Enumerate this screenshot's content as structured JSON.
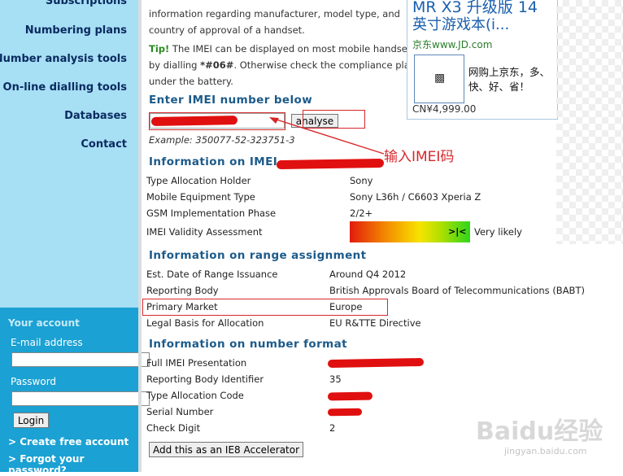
{
  "nav": {
    "items": [
      "Subscriptions",
      "Numbering plans",
      "Number analysis tools",
      "On-line dialling tools",
      "Databases",
      "Contact"
    ]
  },
  "account": {
    "heading": "Your account",
    "email_label": "E-mail address",
    "password_label": "Password",
    "login_label": "Login",
    "create_link": "> Create free account",
    "forgot_link": "> Forgot your password?"
  },
  "intro": {
    "line1": "information regarding manufacturer, model type, and",
    "line2": "country of approval of a handset.",
    "tip_label": "Tip!",
    "tip_line1": " The IMEI can be displayed on most mobile handsets",
    "tip_line2_a": "by dialling ",
    "tip_code": "*#06#",
    "tip_line2_b": ". Otherwise check the compliance plate",
    "tip_line3": "under the battery."
  },
  "enter": {
    "heading": "Enter IMEI number below",
    "analyse_label": "analyse",
    "example": "Example: 350077-52-323751-3",
    "annotation": "输入IMEI码"
  },
  "info_imei": {
    "heading": "Information on IMEI",
    "rows": [
      {
        "label": "Type Allocation Holder",
        "value": "Sony"
      },
      {
        "label": "Mobile Equipment Type",
        "value": "Sony L36h / C6603 Xperia Z"
      },
      {
        "label": "GSM Implementation Phase",
        "value": "2/2+"
      },
      {
        "label": "IMEI Validity Assessment",
        "value": "Very likely"
      }
    ],
    "validity_marker": ">|<"
  },
  "range": {
    "heading": "Information on range assignment",
    "rows": [
      {
        "label": "Est. Date of Range Issuance",
        "value": "Around Q4 2012"
      },
      {
        "label": "Reporting Body",
        "value": "British Approvals Board of Telecommunications (BABT)"
      },
      {
        "label": "Primary Market",
        "value": "Europe"
      },
      {
        "label": "Legal Basis for Allocation",
        "value": "EU R&TTE Directive"
      }
    ]
  },
  "format": {
    "heading": "Information on number format",
    "rows": [
      {
        "label": "Full IMEI Presentation",
        "value": ""
      },
      {
        "label": "Reporting Body Identifier",
        "value": "35"
      },
      {
        "label": "Type Allocation Code",
        "value": ""
      },
      {
        "label": "Serial Number",
        "value": ""
      },
      {
        "label": "Check Digit",
        "value": "2"
      }
    ],
    "ie8_label": "Add this as an IE8 Accelerator"
  },
  "ad": {
    "title_line1": "MR X3 升级版 14",
    "title_line2": "英寸游戏本(i...",
    "domain": "京东www.JD.com",
    "desc": "网购上京东，多、快、好、省！",
    "price": "CN¥4,999.00"
  },
  "watermark": {
    "brand": "Baidu经验",
    "url": "jingyan.baidu.com"
  },
  "colors": {
    "nav_bg": "#a7dff4",
    "account_bg": "#1ba1d3",
    "heading": "#1c5a8a",
    "annotation_red": "#d7272b"
  },
  "icons": {
    "ad_thumb": "image-placeholder-icon"
  }
}
